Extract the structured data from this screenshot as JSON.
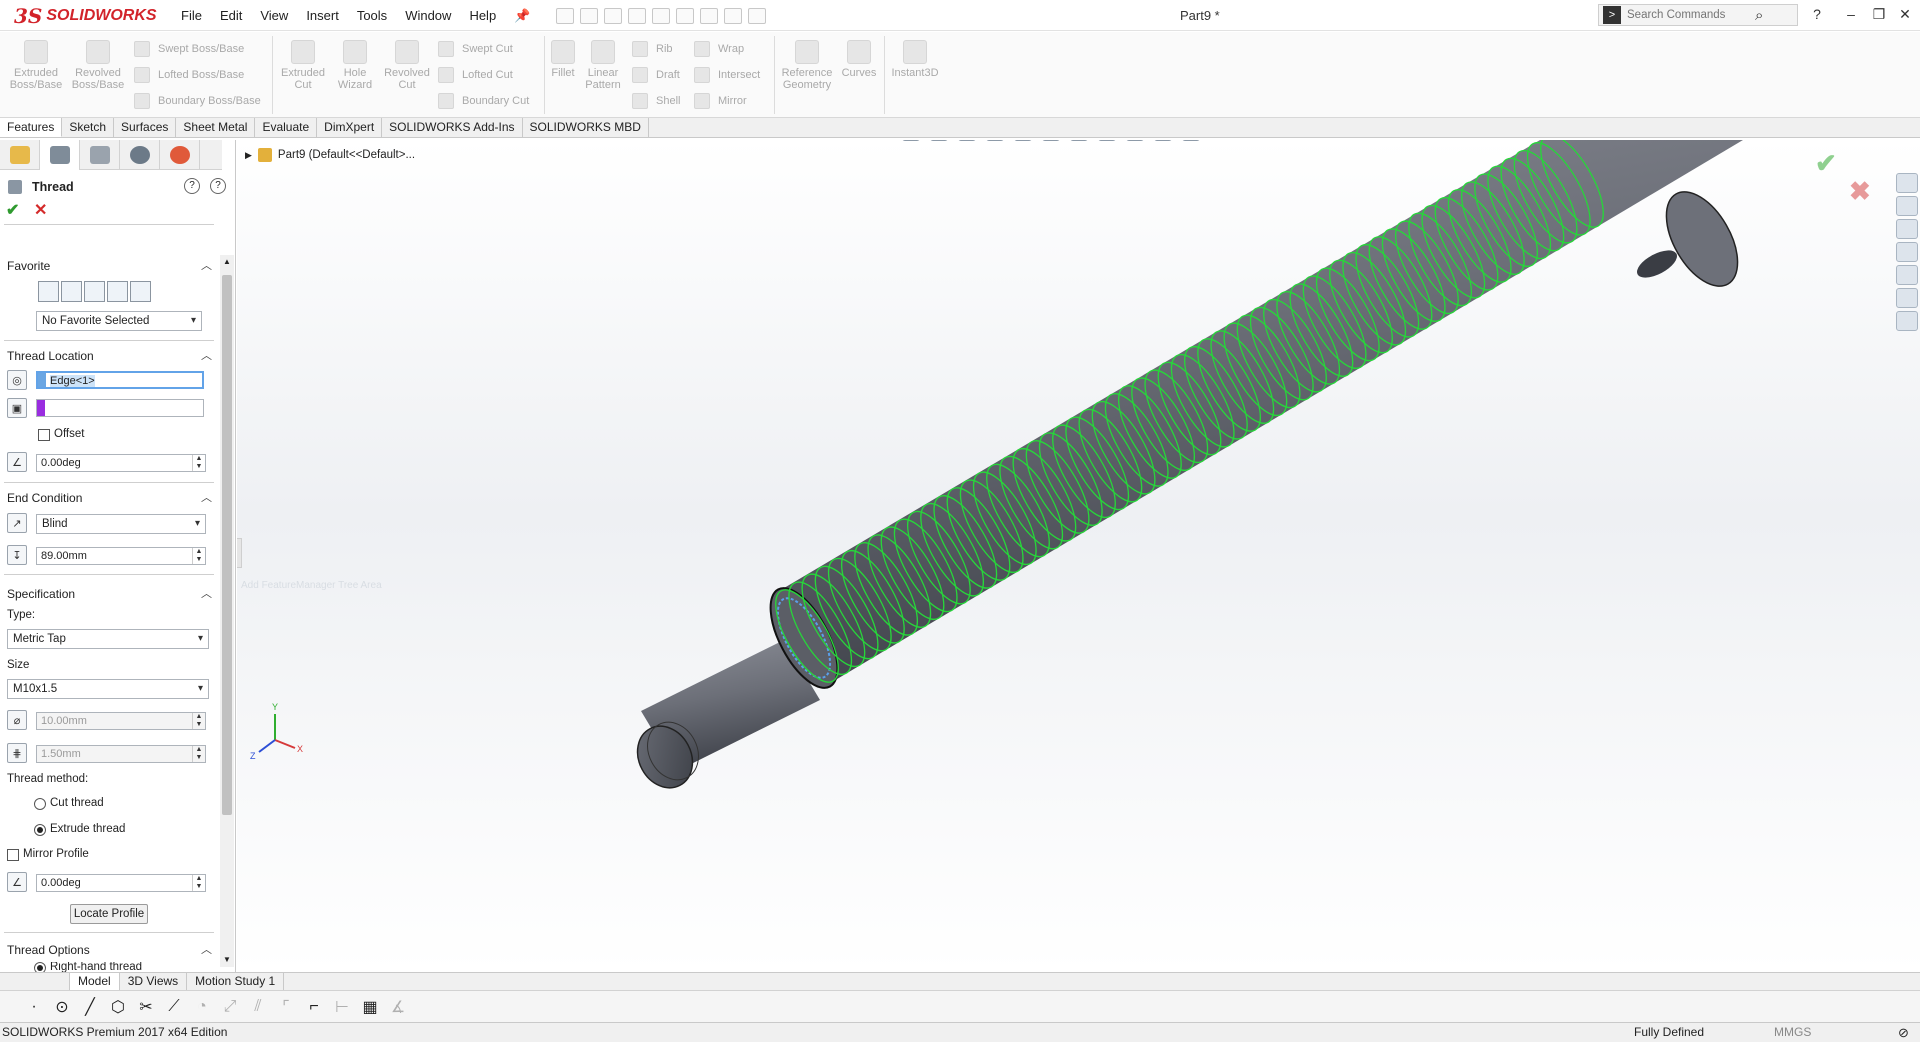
{
  "app": {
    "logo_text": "SOLIDWORKS",
    "doc_title": "Part9 *"
  },
  "menu": [
    "File",
    "Edit",
    "View",
    "Insert",
    "Tools",
    "Window",
    "Help"
  ],
  "search": {
    "placeholder": "Search Commands"
  },
  "toolbar": {
    "extruded_boss": "Extruded Boss/Base",
    "revolved_boss": "Revolved Boss/Base",
    "swept_boss": "Swept Boss/Base",
    "lofted_boss": "Lofted Boss/Base",
    "boundary_boss": "Boundary Boss/Base",
    "extruded_cut": "Extruded Cut",
    "hole_wizard": "Hole Wizard",
    "revolved_cut": "Revolved Cut",
    "swept_cut": "Swept Cut",
    "lofted_cut": "Lofted Cut",
    "boundary_cut": "Boundary Cut",
    "fillet": "Fillet",
    "linear_pattern": "Linear Pattern",
    "rib": "Rib",
    "draft": "Draft",
    "shell": "Shell",
    "wrap": "Wrap",
    "intersect": "Intersect",
    "mirror": "Mirror",
    "reference_geometry": "Reference Geometry",
    "curves": "Curves",
    "instant3d": "Instant3D"
  },
  "cmd_tabs": [
    "Features",
    "Sketch",
    "Surfaces",
    "Sheet Metal",
    "Evaluate",
    "DimXpert",
    "SOLIDWORKS Add-Ins",
    "SOLIDWORKS MBD"
  ],
  "tree": {
    "root": "Part9  (Default<<Default>..."
  },
  "thread_pm": {
    "title": "Thread",
    "favorite": {
      "heading": "Favorite",
      "selected": "No Favorite Selected"
    },
    "location": {
      "heading": "Thread Location",
      "edge": "Edge<1>",
      "face": "",
      "offset_label": "Offset",
      "angle": "0.00deg"
    },
    "end_condition": {
      "heading": "End Condition",
      "type": "Blind",
      "depth": "89.00mm"
    },
    "specification": {
      "heading": "Specification",
      "type_label": "Type:",
      "type": "Metric Tap",
      "size_label": "Size",
      "size": "M10x1.5",
      "diameter": "10.00mm",
      "pitch": "1.50mm",
      "method_label": "Thread method:",
      "cut_thread": "Cut thread",
      "extrude_thread": "Extrude thread",
      "mirror_profile": "Mirror Profile",
      "angle": "0.00deg",
      "locate_profile": "Locate Profile"
    },
    "options": {
      "heading": "Thread Options",
      "right_hand": "Right-hand thread"
    }
  },
  "graphics": {
    "hint": "Add FeatureManager Tree Area"
  },
  "bottom_tabs": [
    "Model",
    "3D Views",
    "Motion Study 1"
  ],
  "status": {
    "left": "SOLIDWORKS Premium 2017 x64 Edition",
    "defined": "Fully Defined",
    "units": "MMGS"
  },
  "colors": {
    "brand": "#d2232a",
    "thread_helix": "#27d63a",
    "shaft": "#5d6068"
  }
}
